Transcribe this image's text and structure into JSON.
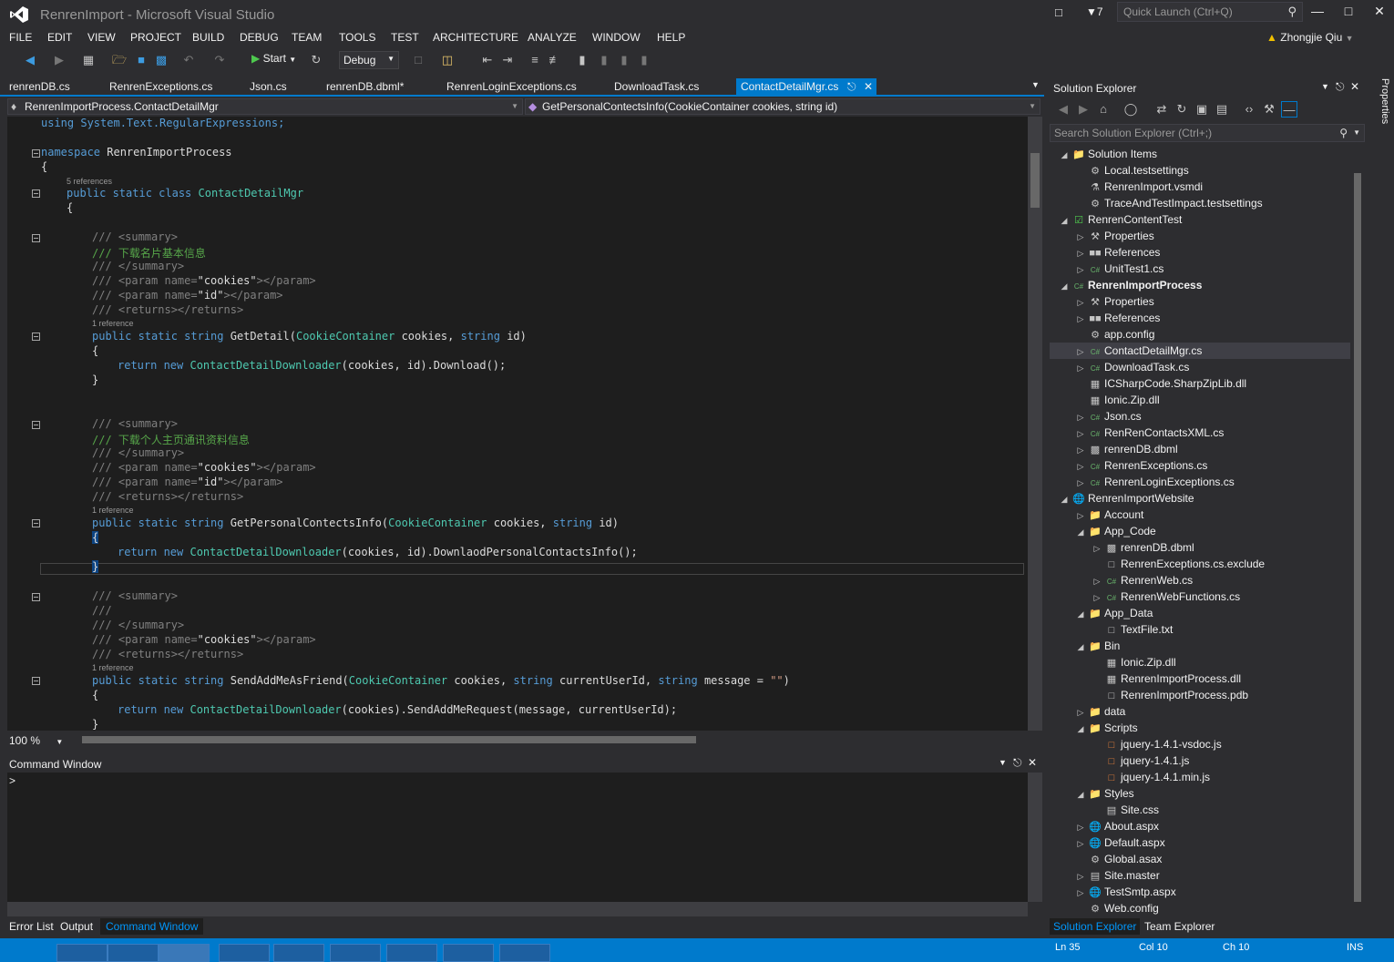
{
  "window": {
    "title": "RenrenImport - Microsoft Visual Studio",
    "notifications_count": "7",
    "quick_launch_placeholder": "Quick Launch (Ctrl+Q)",
    "user": "Zhongjie Qiu"
  },
  "menu": [
    "FILE",
    "EDIT",
    "VIEW",
    "PROJECT",
    "BUILD",
    "DEBUG",
    "TEAM",
    "TOOLS",
    "TEST",
    "ARCHITECTURE",
    "ANALYZE",
    "WINDOW",
    "HELP"
  ],
  "toolbar": {
    "start_label": "Start",
    "config": "Debug"
  },
  "doc_tabs": [
    "renrenDB.cs",
    "RenrenExceptions.cs",
    "Json.cs",
    "renrenDB.dbml*",
    "RenrenLoginExceptions.cs",
    "DownloadTask.cs",
    "ContactDetailMgr.cs"
  ],
  "nav": {
    "type": "RenrenImportProcess.ContactDetailMgr",
    "member": "GetPersonalContectsInfo(CookieContainer cookies, string id)"
  },
  "code": {
    "l1": "using System.Text.RegularExpressions;",
    "ns_kw": "namespace",
    "ns_name": " RenrenImportProcess",
    "brace_open": "{",
    "lens_class": "5 references",
    "class_decl_kw": "public static class",
    "class_name": " ContactDetailMgr",
    "brace_open2": "{",
    "s1": "/// <summary>",
    "s1_desc": "/// 下载名片基本信息",
    "s1_end": "/// </summary>",
    "s1_p1a": "/// <param name=",
    "s1_p1b": "\"cookies\"",
    "s1_p1c": "></param>",
    "s1_p2a": "/// <param name=",
    "s1_p2b": "\"id\"",
    "s1_p2c": "></param>",
    "s1_ret": "/// <returns></returns>",
    "lens1": "1 reference",
    "m1_kw": "public static string",
    "m1_name": " GetDetail(",
    "m1_ty": "CookieContainer",
    "m1_p1": " cookies, ",
    "m1_kw2": "string",
    "m1_p2": " id)",
    "b1": "{",
    "r1_kw": "return new",
    "r1_ty": " ContactDetailDownloader",
    "r1_rest": "(cookies, id).Download();",
    "b1c": "}",
    "s2": "/// <summary>",
    "s2_desc": "/// 下载个人主页通讯资料信息",
    "s2_end": "/// </summary>",
    "s2_p1a": "/// <param name=",
    "s2_p1b": "\"cookies\"",
    "s2_p1c": "></param>",
    "s2_p2a": "/// <param name=",
    "s2_p2b": "\"id\"",
    "s2_p2c": "></param>",
    "s2_ret": "/// <returns></returns>",
    "lens2": "1 reference",
    "m2_kw": "public static string",
    "m2_name": " GetPersonalContectsInfo(",
    "m2_ty": "CookieContainer",
    "m2_p1": " cookies, ",
    "m2_kw2": "string",
    "m2_p2": " id)",
    "b2": "{",
    "r2_kw": "return new",
    "r2_ty": " ContactDetailDownloader",
    "r2_rest": "(cookies, id).DownlaodPersonalContactsInfo();",
    "b2c": "}",
    "s3": "/// <summary>",
    "s3_desc": "///",
    "s3_end": "/// </summary>",
    "s3_p1a": "/// <param name=",
    "s3_p1b": "\"cookies\"",
    "s3_p1c": "></param>",
    "s3_ret": "/// <returns></returns>",
    "lens3": "1 reference",
    "m3_kw": "public static string",
    "m3_name": " SendAddMeAsFriend(",
    "m3_ty": "CookieContainer",
    "m3_p1": " cookies, ",
    "m3_kw2": "string",
    "m3_p2": " currentUserId, ",
    "m3_kw3": "string",
    "m3_p3": " message = ",
    "m3_str": "\"\"",
    "m3_end": ")",
    "b3": "{",
    "r3_kw": "return new",
    "r3_ty": " ContactDetailDownloader",
    "r3_rest": "(cookies).SendAddMeRequest(message, currentUserId);",
    "b3c": "}"
  },
  "zoom": "100 %",
  "command_window": {
    "title": "Command Window",
    "prompt": ">"
  },
  "bottom_tabs": [
    "Error List",
    "Output",
    "Command Window"
  ],
  "solution_explorer": {
    "title": "Solution Explorer",
    "search_placeholder": "Search Solution Explorer (Ctrl+;)",
    "items": [
      {
        "label": "Solution Items",
        "depth": 0,
        "arrow": "open",
        "icon": "folder-icon"
      },
      {
        "label": "Local.testsettings",
        "depth": 1,
        "arrow": "",
        "icon": "settings-icon"
      },
      {
        "label": "RenrenImport.vsmdi",
        "depth": 1,
        "arrow": "",
        "icon": "flask-icon"
      },
      {
        "label": "TraceAndTestImpact.testsettings",
        "depth": 1,
        "arrow": "",
        "icon": "settings-icon"
      },
      {
        "label": "RenrenContentTest",
        "depth": 0,
        "arrow": "open",
        "icon": "test-project-icon"
      },
      {
        "label": "Properties",
        "depth": 1,
        "arrow": "closed",
        "icon": "wrench-icon"
      },
      {
        "label": "References",
        "depth": 1,
        "arrow": "closed",
        "icon": "references-icon"
      },
      {
        "label": "UnitTest1.cs",
        "depth": 1,
        "arrow": "closed",
        "icon": "csharp-icon"
      },
      {
        "label": "RenrenImportProcess",
        "depth": 0,
        "arrow": "open",
        "icon": "csharp-project-icon",
        "bold": true
      },
      {
        "label": "Properties",
        "depth": 1,
        "arrow": "closed",
        "icon": "wrench-icon"
      },
      {
        "label": "References",
        "depth": 1,
        "arrow": "closed",
        "icon": "references-icon"
      },
      {
        "label": "app.config",
        "depth": 1,
        "arrow": "",
        "icon": "config-icon"
      },
      {
        "label": "ContactDetailMgr.cs",
        "depth": 1,
        "arrow": "closed",
        "icon": "csharp-icon",
        "selected": true
      },
      {
        "label": "DownloadTask.cs",
        "depth": 1,
        "arrow": "closed",
        "icon": "csharp-icon"
      },
      {
        "label": "ICSharpCode.SharpZipLib.dll",
        "depth": 1,
        "arrow": "",
        "icon": "dll-icon"
      },
      {
        "label": "Ionic.Zip.dll",
        "depth": 1,
        "arrow": "",
        "icon": "dll-icon"
      },
      {
        "label": "Json.cs",
        "depth": 1,
        "arrow": "closed",
        "icon": "csharp-icon"
      },
      {
        "label": "RenRenContactsXML.cs",
        "depth": 1,
        "arrow": "closed",
        "icon": "csharp-icon"
      },
      {
        "label": "renrenDB.dbml",
        "depth": 1,
        "arrow": "closed",
        "icon": "dbml-icon"
      },
      {
        "label": "RenrenExceptions.cs",
        "depth": 1,
        "arrow": "closed",
        "icon": "csharp-icon"
      },
      {
        "label": "RenrenLoginExceptions.cs",
        "depth": 1,
        "arrow": "closed",
        "icon": "csharp-icon"
      },
      {
        "label": "RenrenImportWebsite",
        "depth": 0,
        "arrow": "open",
        "icon": "globe-icon"
      },
      {
        "label": "Account",
        "depth": 1,
        "arrow": "closed",
        "icon": "folder-icon"
      },
      {
        "label": "App_Code",
        "depth": 1,
        "arrow": "open",
        "icon": "folder-icon"
      },
      {
        "label": "renrenDB.dbml",
        "depth": 2,
        "arrow": "closed",
        "icon": "dbml-icon"
      },
      {
        "label": "RenrenExceptions.cs.exclude",
        "depth": 2,
        "arrow": "",
        "icon": "file-icon"
      },
      {
        "label": "RenrenWeb.cs",
        "depth": 2,
        "arrow": "closed",
        "icon": "csharp-icon"
      },
      {
        "label": "RenrenWebFunctions.cs",
        "depth": 2,
        "arrow": "closed",
        "icon": "csharp-icon"
      },
      {
        "label": "App_Data",
        "depth": 1,
        "arrow": "open",
        "icon": "folder-icon"
      },
      {
        "label": "TextFile.txt",
        "depth": 2,
        "arrow": "",
        "icon": "file-icon"
      },
      {
        "label": "Bin",
        "depth": 1,
        "arrow": "open",
        "icon": "folder-icon"
      },
      {
        "label": "Ionic.Zip.dll",
        "depth": 2,
        "arrow": "",
        "icon": "dll-icon"
      },
      {
        "label": "RenrenImportProcess.dll",
        "depth": 2,
        "arrow": "",
        "icon": "dll-icon"
      },
      {
        "label": "RenrenImportProcess.pdb",
        "depth": 2,
        "arrow": "",
        "icon": "file-icon"
      },
      {
        "label": "data",
        "depth": 1,
        "arrow": "closed",
        "icon": "folder-icon"
      },
      {
        "label": "Scripts",
        "depth": 1,
        "arrow": "open",
        "icon": "folder-icon"
      },
      {
        "label": "jquery-1.4.1-vsdoc.js",
        "depth": 2,
        "arrow": "",
        "icon": "js-icon"
      },
      {
        "label": "jquery-1.4.1.js",
        "depth": 2,
        "arrow": "",
        "icon": "js-icon"
      },
      {
        "label": "jquery-1.4.1.min.js",
        "depth": 2,
        "arrow": "",
        "icon": "js-icon"
      },
      {
        "label": "Styles",
        "depth": 1,
        "arrow": "open",
        "icon": "folder-icon"
      },
      {
        "label": "Site.css",
        "depth": 2,
        "arrow": "",
        "icon": "css-icon"
      },
      {
        "label": "About.aspx",
        "depth": 1,
        "arrow": "closed",
        "icon": "aspx-icon"
      },
      {
        "label": "Default.aspx",
        "depth": 1,
        "arrow": "closed",
        "icon": "aspx-icon"
      },
      {
        "label": "Global.asax",
        "depth": 1,
        "arrow": "",
        "icon": "asax-icon"
      },
      {
        "label": "Site.master",
        "depth": 1,
        "arrow": "closed",
        "icon": "master-icon"
      },
      {
        "label": "TestSmtp.aspx",
        "depth": 1,
        "arrow": "closed",
        "icon": "aspx-icon"
      },
      {
        "label": "Web.config",
        "depth": 1,
        "arrow": "",
        "icon": "config-icon"
      }
    ],
    "bottom_tabs": [
      "Solution Explorer",
      "Team Explorer"
    ]
  },
  "properties_side_label": "Properties",
  "status": {
    "ln": "Ln 35",
    "col": "Col 10",
    "ch": "Ch 10",
    "mode": "INS"
  },
  "colors": {
    "accent": "#007acc",
    "bg": "#2d2d30",
    "editor_bg": "#1e1e1e"
  }
}
